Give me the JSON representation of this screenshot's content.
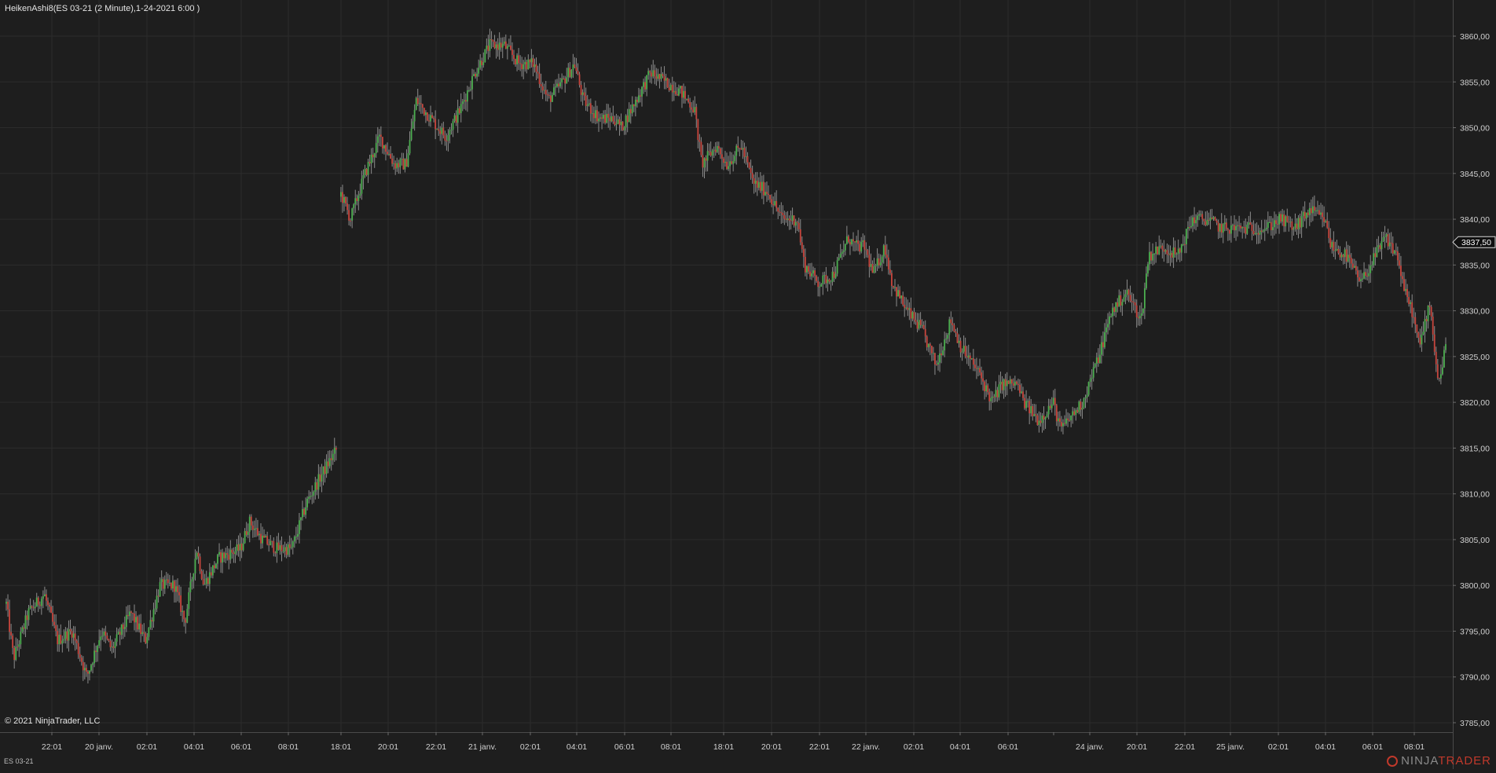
{
  "header": {
    "indicator_label": "HeikenAshi8(ES 03-21 (2 Minute),1-24-2021 6:00 )"
  },
  "footer": {
    "copyright": "© 2021 NinjaTrader, LLC",
    "instrument": "ES 03-21",
    "brand_part1": "NINJA",
    "brand_part2": "TRADER"
  },
  "colors": {
    "background": "#1e1e1e",
    "grid": "#2c2c2c",
    "axis_text": "#d0d0d0",
    "up_bar": "#4caf50",
    "down_bar": "#c8453d",
    "wick": "#8c8c8c",
    "current_price_marker_bg": "#101010"
  },
  "chart_data": {
    "type": "candlestick",
    "series_name": "HeikenAshi8",
    "instrument": "ES 03-21",
    "interval": "2 Minute",
    "grid": true,
    "ylim": [
      3784,
      3864
    ],
    "y_ticks": [
      3785,
      3790,
      3795,
      3800,
      3805,
      3810,
      3815,
      3820,
      3825,
      3830,
      3835,
      3840,
      3845,
      3850,
      3855,
      3860
    ],
    "y_tick_labels": [
      "3785,00",
      "3790,00",
      "3795,00",
      "3800,00",
      "3805,00",
      "3810,00",
      "3815,00",
      "3820,00",
      "3825,00",
      "3830,00",
      "3835,00",
      "3840,00",
      "3845,00",
      "3850,00",
      "3855,00",
      "3860,00"
    ],
    "x_tick_labels": [
      "22:01",
      "20 janv.",
      "02:01",
      "04:01",
      "06:01",
      "08:01",
      "18:01",
      "20:01",
      "22:01",
      "21 janv.",
      "02:01",
      "04:01",
      "06:01",
      "08:01",
      "18:01",
      "20:01",
      "22:01",
      "22 janv.",
      "02:01",
      "04:01",
      "06:01",
      "24 janv.",
      "20:01",
      "22:01",
      "25 janv.",
      "02:01",
      "04:01",
      "06:01",
      "08:01"
    ],
    "current_price": 3837.5,
    "current_price_label": "3837,50",
    "session_gap_index": 6,
    "price_path": [
      [
        0,
        3798
      ],
      [
        0.5,
        3792
      ],
      [
        1.5,
        3797
      ],
      [
        2.6,
        3799
      ],
      [
        3.5,
        3794
      ],
      [
        4.5,
        3795
      ],
      [
        5.5,
        3790
      ],
      [
        6.5,
        3795
      ],
      [
        7.2,
        3793
      ],
      [
        8.5,
        3797
      ],
      [
        9.5,
        3794
      ],
      [
        10.5,
        3800
      ],
      [
        11.5,
        3800
      ],
      [
        12.2,
        3796
      ],
      [
        13,
        3804
      ],
      [
        13.5,
        3800
      ],
      [
        14.5,
        3803
      ],
      [
        16,
        3804
      ],
      [
        16.6,
        3807
      ],
      [
        17.5,
        3805
      ],
      [
        18.5,
        3804
      ],
      [
        19.5,
        3804
      ],
      [
        20.5,
        3809
      ],
      [
        21.5,
        3812
      ],
      [
        22.6,
        3815
      ],
      [
        22.8,
        3843
      ],
      [
        23.5,
        3840
      ],
      [
        24.5,
        3845
      ],
      [
        25.5,
        3849
      ],
      [
        26.5,
        3846
      ],
      [
        27.3,
        3846
      ],
      [
        28,
        3853
      ],
      [
        29,
        3851
      ],
      [
        30,
        3849
      ],
      [
        31,
        3852
      ],
      [
        32,
        3856
      ],
      [
        33,
        3859
      ],
      [
        34,
        3859
      ],
      [
        35,
        3857
      ],
      [
        36,
        3857
      ],
      [
        37,
        3853
      ],
      [
        38,
        3855
      ],
      [
        38.8,
        3857
      ],
      [
        39.4,
        3853
      ],
      [
        40.5,
        3851
      ],
      [
        41.5,
        3851
      ],
      [
        42,
        3850
      ],
      [
        43,
        3853
      ],
      [
        44,
        3856
      ],
      [
        45,
        3855
      ],
      [
        46,
        3854
      ],
      [
        47,
        3852
      ],
      [
        47.5,
        3846
      ],
      [
        48.5,
        3848
      ],
      [
        49.2,
        3846
      ],
      [
        50.2,
        3848
      ],
      [
        51,
        3844
      ],
      [
        52,
        3843
      ],
      [
        53,
        3840
      ],
      [
        54,
        3840
      ],
      [
        54.5,
        3835
      ],
      [
        55.5,
        3833
      ],
      [
        56.5,
        3834
      ],
      [
        57.5,
        3838
      ],
      [
        58,
        3837
      ],
      [
        58.6,
        3837
      ],
      [
        59.2,
        3834
      ],
      [
        60,
        3837
      ],
      [
        60.5,
        3833
      ],
      [
        61.5,
        3830
      ],
      [
        62.5,
        3828
      ],
      [
        63.5,
        3824
      ],
      [
        64.5,
        3829
      ],
      [
        65.2,
        3826
      ],
      [
        66.5,
        3823
      ],
      [
        67.3,
        3820
      ],
      [
        68,
        3822
      ],
      [
        69,
        3822
      ],
      [
        69.5,
        3820
      ],
      [
        70.5,
        3818
      ],
      [
        71.5,
        3820
      ],
      [
        72,
        3817
      ],
      [
        73.5,
        3820
      ],
      [
        74.6,
        3825
      ],
      [
        75.5,
        3830
      ],
      [
        76.5,
        3832
      ],
      [
        77.5,
        3829
      ],
      [
        78,
        3836
      ],
      [
        79,
        3837
      ],
      [
        80,
        3836
      ],
      [
        81,
        3840
      ],
      [
        82,
        3840
      ],
      [
        83,
        3839
      ],
      [
        84,
        3839
      ],
      [
        85,
        3839
      ],
      [
        86,
        3839
      ],
      [
        87,
        3840
      ],
      [
        88,
        3839
      ],
      [
        89,
        3841
      ],
      [
        90,
        3840
      ],
      [
        90.5,
        3837
      ],
      [
        91.5,
        3836
      ],
      [
        92.5,
        3833
      ],
      [
        93.5,
        3836
      ],
      [
        94.2,
        3838
      ],
      [
        95,
        3836
      ],
      [
        95.5,
        3832
      ],
      [
        96,
        3830
      ],
      [
        96.5,
        3826
      ],
      [
        97.2,
        3831
      ],
      [
        97.8,
        3822
      ],
      [
        98.3,
        3826
      ]
    ],
    "bar_count": 900
  }
}
